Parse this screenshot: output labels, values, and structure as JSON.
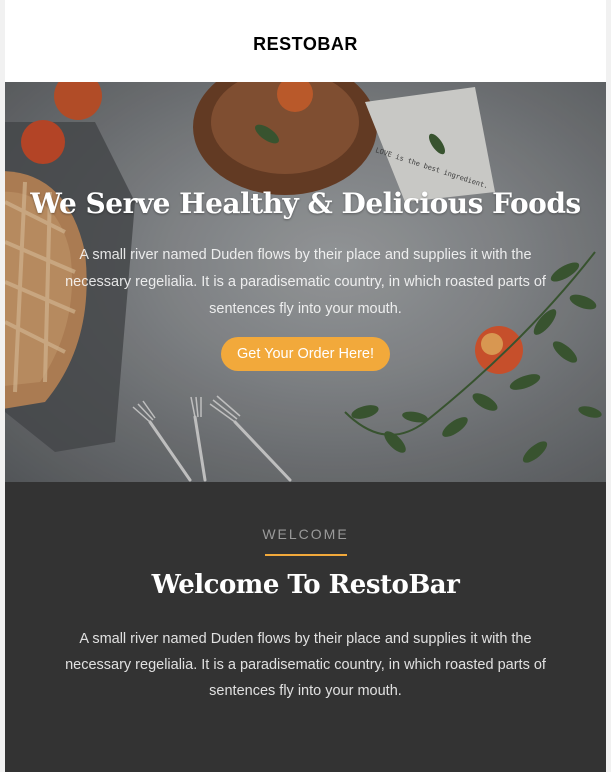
{
  "header": {
    "logo": "RESTOBAR"
  },
  "hero": {
    "title": "We Serve Healthy & Delicious Foods",
    "text": "A small river named Duden flows by their place and supplies it with the necessary regelialia. It is a paradisematic country, in which roasted parts of sentences fly into your mouth.",
    "cta_label": "Get Your Order Here!",
    "napkin_text": "LOVE is the best ingredient."
  },
  "welcome": {
    "eyebrow": "WELCOME",
    "title": "Welcome To RestoBar",
    "text": "A small river named Duden flows by their place and supplies it with the necessary regelialia. It is a paradisematic country, in which roasted parts of sentences fly into your mouth."
  },
  "colors": {
    "accent": "#f2a93b",
    "dark_section": "#333333",
    "header_bg": "#ffffff"
  }
}
